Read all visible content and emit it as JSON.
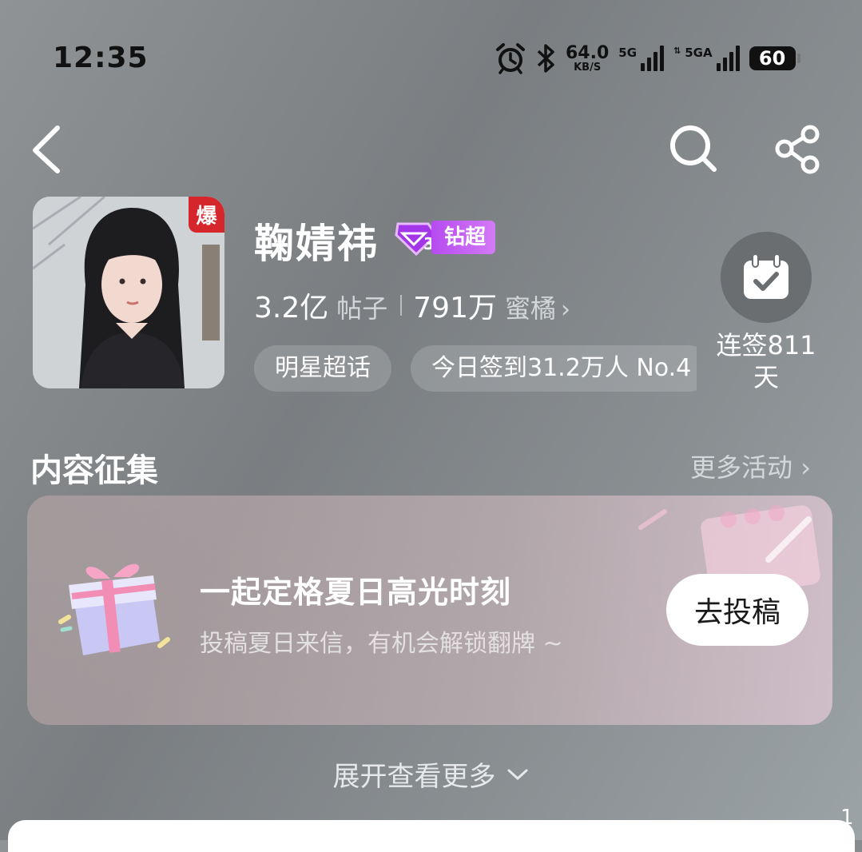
{
  "status_bar": {
    "time": "12:35",
    "net_speed_value": "64.0",
    "net_speed_unit": "KB/S",
    "sim1_label": "5G",
    "sim2_label": "5GA",
    "battery": "60",
    "icons": [
      "alarm-icon",
      "bluetooth-icon",
      "signal-icon",
      "battery-icon"
    ]
  },
  "nav": {
    "icons": [
      "back-icon",
      "search-icon",
      "share-icon"
    ]
  },
  "topic": {
    "name": "鞠婧祎",
    "hot_badge": "爆",
    "level_badge": "钻超",
    "posts_value": "3.2亿",
    "posts_label": "帖子",
    "fans_value": "791万",
    "fans_label": "蜜橘",
    "tags": [
      "明星超话",
      "今日签到31.2万人 No.4"
    ]
  },
  "signin": {
    "label": "连签811天",
    "icon": "calendar-check-icon"
  },
  "content_section": {
    "title": "内容征集",
    "more_label": "更多活动"
  },
  "campaign_card": {
    "title": "一起定格夏日高光时刻",
    "subtitle": "投稿夏日来信，有机会解锁翻牌 ~",
    "button_label": "去投稿",
    "icon": "gift-box-icon"
  },
  "expand_label": "展开查看更多",
  "bottom_number": "1",
  "colors": {
    "hot_badge": "#d5262b",
    "level_badge": "#c05ef2",
    "background": "#84888b"
  }
}
